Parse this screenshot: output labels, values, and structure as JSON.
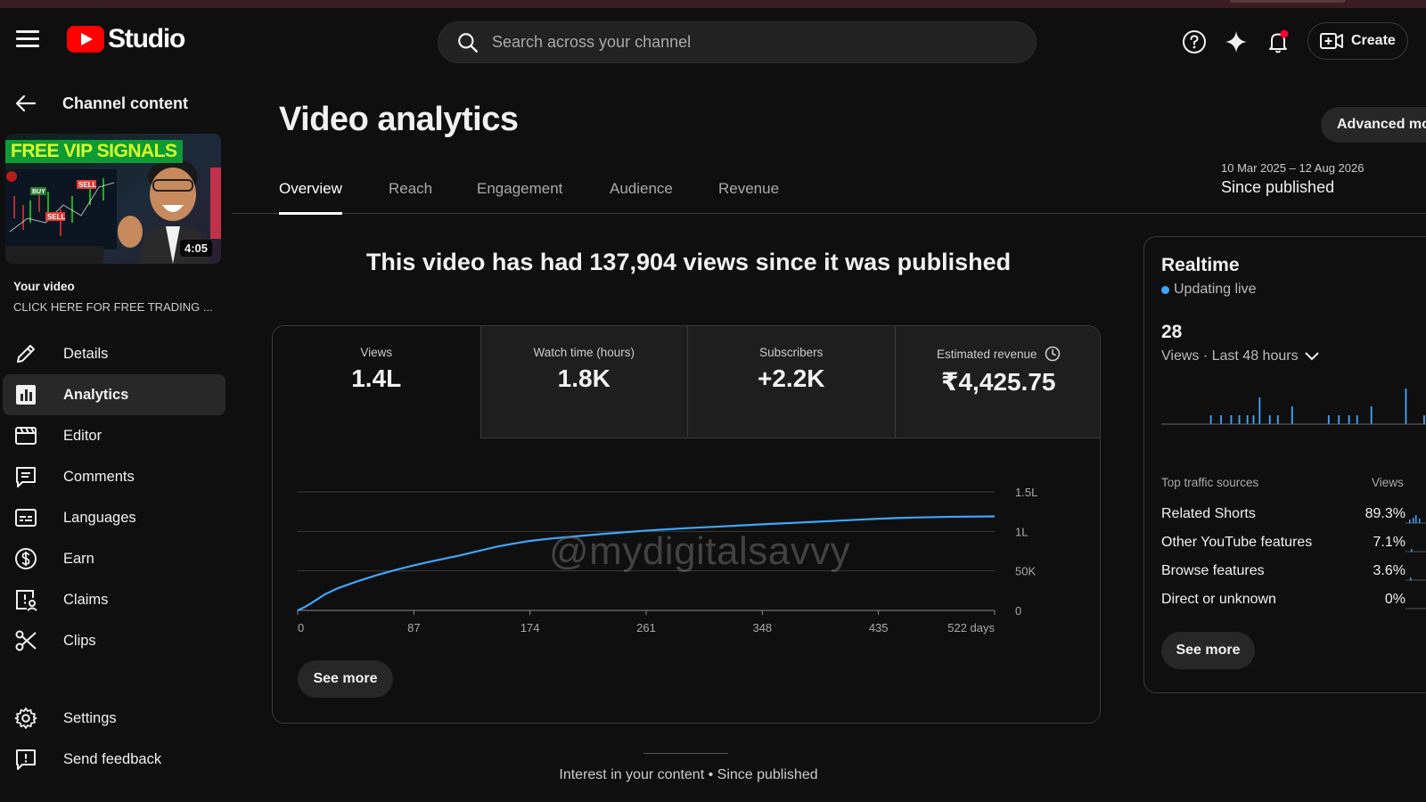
{
  "header": {
    "logo_text": "Studio",
    "search_placeholder": "Search across your channel",
    "create_label": "Create"
  },
  "sidebar": {
    "title": "Channel content",
    "thumbnail": {
      "banner_text": "FREE VIP SIGNALS",
      "duration": "4:05"
    },
    "your_video_label": "Your video",
    "video_title": "CLICK HERE FOR FREE TRADING ...",
    "items": [
      {
        "label": "Details",
        "icon": "pencil-icon"
      },
      {
        "label": "Analytics",
        "icon": "analytics-icon",
        "active": true
      },
      {
        "label": "Editor",
        "icon": "editor-icon"
      },
      {
        "label": "Comments",
        "icon": "comments-icon"
      },
      {
        "label": "Languages",
        "icon": "subtitles-icon"
      },
      {
        "label": "Earn",
        "icon": "dollar-icon"
      },
      {
        "label": "Claims",
        "icon": "claims-icon"
      },
      {
        "label": "Clips",
        "icon": "scissors-icon"
      }
    ],
    "bottom_items": [
      {
        "label": "Settings",
        "icon": "gear-icon"
      },
      {
        "label": "Send feedback",
        "icon": "feedback-icon"
      }
    ]
  },
  "main": {
    "page_title": "Video analytics",
    "advanced_mode_label": "Advanced mode",
    "date_range": "10 Mar 2025 – 12 Aug 2026",
    "period": "Since published",
    "tabs": [
      "Overview",
      "Reach",
      "Engagement",
      "Audience",
      "Revenue"
    ],
    "active_tab": "Overview",
    "headline": "This video has had 137,904 views since it was published",
    "metrics": [
      {
        "label": "Views",
        "value": "1.4L"
      },
      {
        "label": "Watch time (hours)",
        "value": "1.8K"
      },
      {
        "label": "Subscribers",
        "value": "+2.2K"
      },
      {
        "label": "Estimated revenue",
        "value": "₹4,425.75"
      }
    ],
    "watermark": "@mydigitalsavvy",
    "see_more_label": "See more",
    "interest_caption": "Interest in your content • Since published"
  },
  "chart_data": {
    "type": "line",
    "series": [
      {
        "x": [
          0,
          5,
          10,
          20,
          30,
          45,
          60,
          75,
          87,
          100,
          120,
          140,
          150,
          160,
          174,
          190,
          210,
          230,
          261,
          290,
          320,
          348,
          380,
          410,
          435,
          460,
          490,
          522
        ],
        "values": [
          0,
          4000,
          9000,
          20000,
          28000,
          37000,
          45000,
          52000,
          57000,
          62000,
          69000,
          77000,
          81000,
          84000,
          88000,
          91000,
          94000,
          97000,
          101000,
          104000,
          106500,
          109000,
          111500,
          114000,
          116000,
          117500,
          118500,
          119000
        ]
      }
    ],
    "x_ticks": [
      "0",
      "87",
      "174",
      "261",
      "348",
      "435",
      "522 days"
    ],
    "y_ticks": [
      "0",
      "50K",
      "1L",
      "1.5L"
    ],
    "y_tick_values": [
      0,
      50000,
      100000,
      150000
    ],
    "xlim": [
      0,
      522
    ],
    "ylim": [
      0,
      150000
    ],
    "grid": true,
    "color": "#3ea6ff"
  },
  "realtime": {
    "title": "Realtime",
    "live_label": "Updating live",
    "count": "28",
    "subtitle": "Views · Last 48 hours",
    "bars_relative": [
      0,
      0,
      0,
      0,
      0,
      0,
      0,
      0,
      0,
      0,
      0,
      0,
      0,
      0,
      0,
      0,
      0,
      0,
      0,
      0,
      0,
      0,
      0,
      0,
      1,
      0,
      0,
      0,
      0,
      1,
      0,
      0,
      0,
      0,
      1,
      0,
      0,
      0,
      1,
      0,
      0,
      0,
      1,
      0,
      0,
      1,
      0,
      0,
      3,
      0,
      0,
      0,
      0,
      1,
      0,
      0,
      0,
      1,
      0,
      0,
      0,
      0,
      0,
      0,
      2,
      0,
      0,
      0,
      0,
      0,
      0,
      0,
      0,
      0,
      0,
      0,
      0,
      0,
      0,
      0,
      0,
      0,
      1,
      0,
      0,
      0,
      0,
      1,
      0,
      0,
      0,
      0,
      1,
      0,
      0,
      0,
      1,
      0,
      0,
      0,
      0,
      0,
      0,
      2,
      0,
      0,
      0,
      0,
      0,
      0,
      0,
      0,
      0,
      0,
      0,
      0,
      0,
      0,
      0,
      0,
      4,
      0,
      0,
      0,
      0,
      0,
      0,
      0,
      0,
      1,
      0,
      0,
      0,
      0,
      0,
      2
    ],
    "traffic_header": {
      "source": "Top traffic sources",
      "views": "Views"
    },
    "traffic": [
      {
        "source": "Related Shorts",
        "pct": "89.3%"
      },
      {
        "source": "Other YouTube features",
        "pct": "7.1%"
      },
      {
        "source": "Browse features",
        "pct": "3.6%"
      },
      {
        "source": "Direct or unknown",
        "pct": "0%"
      }
    ],
    "see_more_label": "See more",
    "accent": "#3ea6ff"
  }
}
